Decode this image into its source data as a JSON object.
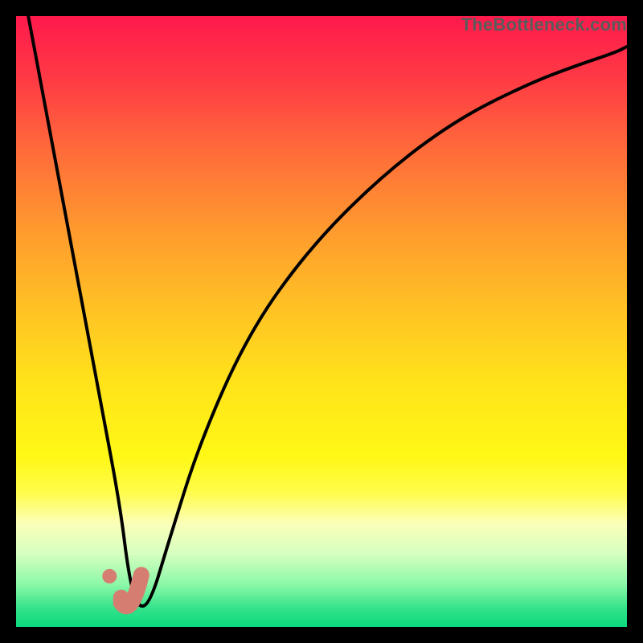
{
  "watermark": {
    "text": "TheBottleneck.com"
  },
  "gradient": {
    "stops": [
      {
        "offset": 0.0,
        "color": "#ff1a4c"
      },
      {
        "offset": 0.1,
        "color": "#ff3945"
      },
      {
        "offset": 0.22,
        "color": "#ff6b3a"
      },
      {
        "offset": 0.35,
        "color": "#ff9a2e"
      },
      {
        "offset": 0.48,
        "color": "#ffc224"
      },
      {
        "offset": 0.6,
        "color": "#ffe31a"
      },
      {
        "offset": 0.72,
        "color": "#fff815"
      },
      {
        "offset": 0.78,
        "color": "#fffc4a"
      },
      {
        "offset": 0.83,
        "color": "#fbffb8"
      },
      {
        "offset": 0.88,
        "color": "#d6ffc0"
      },
      {
        "offset": 0.93,
        "color": "#8cf8a8"
      },
      {
        "offset": 0.97,
        "color": "#33e28a"
      },
      {
        "offset": 1.0,
        "color": "#0bd97d"
      }
    ]
  },
  "chart_data": {
    "type": "line",
    "title": "",
    "xlabel": "",
    "ylabel": "",
    "xlim": [
      0,
      100
    ],
    "ylim": [
      0,
      100
    ],
    "series": [
      {
        "name": "bottleneck-curve",
        "x": [
          2,
          5,
          8,
          11,
          14,
          17,
          18.5,
          20,
          22,
          25,
          30,
          38,
          48,
          60,
          72,
          84,
          92,
          98,
          100
        ],
        "y": [
          100,
          84,
          68,
          52,
          36,
          20,
          8,
          3,
          4,
          14,
          30,
          48,
          62,
          74,
          83,
          89,
          92,
          94,
          95
        ]
      }
    ],
    "markers": [
      {
        "name": "operating-point-dot",
        "x": 15.3,
        "y": 8.3
      },
      {
        "name": "operating-range-arc",
        "x0": 17.2,
        "y0": 4.0,
        "x1": 20.5,
        "y1": 8.5
      }
    ],
    "marker_color": "#d67d71"
  }
}
